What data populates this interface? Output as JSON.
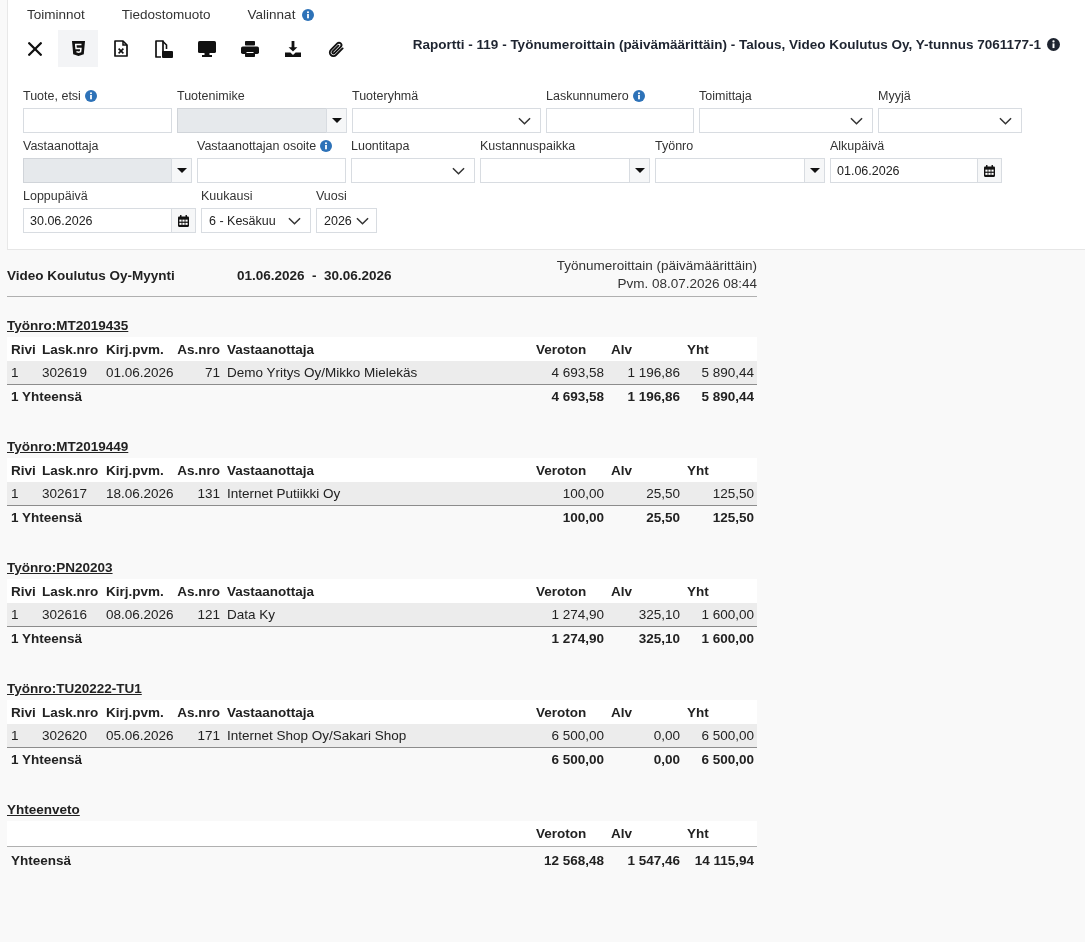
{
  "menu": [
    {
      "label": "Toiminnot",
      "info": false
    },
    {
      "label": "Tiedostomuoto",
      "info": false
    },
    {
      "label": "Valinnat",
      "info": true
    }
  ],
  "toolbar": [
    {
      "kind": "close",
      "selected": false
    },
    {
      "kind": "html",
      "selected": true
    },
    {
      "kind": "excel",
      "selected": false
    },
    {
      "kind": "pdf",
      "selected": false
    },
    {
      "kind": "screen",
      "selected": false
    },
    {
      "kind": "print",
      "selected": false
    },
    {
      "kind": "download",
      "selected": false
    },
    {
      "kind": "attach",
      "selected": false
    }
  ],
  "report_title": {
    "text": "Raportti - 119 - Työnumeroittain (päivämäärittäin) - Talous, Video Koulutus Oy, Y-tunnus 7061177-1",
    "info": true
  },
  "filters": [
    [
      {
        "label": "Tuote, etsi",
        "info": true,
        "kind": "text",
        "disabled": false
      },
      {
        "label": "Tuotenimike",
        "info": false,
        "kind": "combo",
        "disabled": true
      },
      {
        "label": "Tuoteryhmä",
        "info": false,
        "kind": "select",
        "disabled": false
      },
      {
        "label": "Laskunnumero",
        "info": true,
        "kind": "text",
        "disabled": false
      },
      {
        "label": "Toimittaja",
        "info": false,
        "kind": "select",
        "disabled": false
      },
      {
        "label": "Myyjä",
        "info": false,
        "kind": "select",
        "disabled": false
      }
    ],
    [
      {
        "label": "Vastaanottaja",
        "info": false,
        "kind": "combo",
        "disabled": true
      },
      {
        "label": "Vastaanottajan osoite",
        "info": true,
        "kind": "text",
        "disabled": false
      },
      {
        "label": "Luontitapa",
        "info": false,
        "kind": "select",
        "disabled": false
      },
      {
        "label": "Kustannuspaikka",
        "info": false,
        "kind": "combo",
        "disabled": false
      },
      {
        "label": "Työnro",
        "info": false,
        "kind": "combo",
        "disabled": false
      },
      {
        "label": "Alkupäivä",
        "info": false,
        "kind": "date",
        "disabled": false,
        "value": "01.06.2026"
      }
    ],
    [
      {
        "label": "Loppupäivä",
        "info": false,
        "kind": "date",
        "disabled": false,
        "value": "30.06.2026"
      },
      {
        "label": "Kuukausi",
        "info": false,
        "kind": "select",
        "disabled": false,
        "value": "6 - Kesäkuu"
      },
      {
        "label": "Vuosi",
        "info": false,
        "kind": "select",
        "disabled": false,
        "value": "2026"
      }
    ]
  ],
  "report": {
    "company": "Video Koulutus Oy-Myynti",
    "period": "01.06.2026  -  30.06.2026",
    "report_type": "Työnumeroittain (päivämäärittäin)",
    "printed": "Pvm. 08.07.2026 08:44",
    "groups": [
      {
        "title": "Työnro:MT2019435",
        "columns": [
          "Rivi",
          "Lask.nro",
          "Kirj.pvm.",
          "As.nro",
          "Vastaanottaja",
          "Veroton",
          "Alv",
          "Yht"
        ],
        "rows": [
          [
            "1",
            "302619",
            "01.06.2026",
            "71",
            "Demo Yritys Oy/Mikko Mielekäs",
            "4 693,58",
            "1 196,86",
            "5 890,44"
          ]
        ],
        "total": {
          "label": "1 Yhteensä",
          "values": [
            "4 693,58",
            "1 196,86",
            "5 890,44"
          ]
        }
      },
      {
        "title": "Työnro:MT2019449",
        "columns": [
          "Rivi",
          "Lask.nro",
          "Kirj.pvm.",
          "As.nro",
          "Vastaanottaja",
          "Veroton",
          "Alv",
          "Yht"
        ],
        "rows": [
          [
            "1",
            "302617",
            "18.06.2026",
            "131",
            "Internet Putiikki Oy",
            "100,00",
            "25,50",
            "125,50"
          ]
        ],
        "total": {
          "label": "1 Yhteensä",
          "values": [
            "100,00",
            "25,50",
            "125,50"
          ]
        }
      },
      {
        "title": "Työnro:PN20203",
        "columns": [
          "Rivi",
          "Lask.nro",
          "Kirj.pvm.",
          "As.nro",
          "Vastaanottaja",
          "Veroton",
          "Alv",
          "Yht"
        ],
        "rows": [
          [
            "1",
            "302616",
            "08.06.2026",
            "121",
            "Data Ky",
            "1 274,90",
            "325,10",
            "1 600,00"
          ]
        ],
        "total": {
          "label": "1 Yhteensä",
          "values": [
            "1 274,90",
            "325,10",
            "1 600,00"
          ]
        }
      },
      {
        "title": "Työnro:TU20222-TU1",
        "columns": [
          "Rivi",
          "Lask.nro",
          "Kirj.pvm.",
          "As.nro",
          "Vastaanottaja",
          "Veroton",
          "Alv",
          "Yht"
        ],
        "rows": [
          [
            "1",
            "302620",
            "05.06.2026",
            "171",
            "Internet Shop Oy/Sakari Shop",
            "6 500,00",
            "0,00",
            "6 500,00"
          ]
        ],
        "total": {
          "label": "1 Yhteensä",
          "values": [
            "6 500,00",
            "0,00",
            "6 500,00"
          ]
        }
      }
    ],
    "summary": {
      "title": "Yhteenveto",
      "columns": [
        "Veroton",
        "Alv",
        "Yht"
      ],
      "total": {
        "label": "Yhteensä",
        "values": [
          "12 568,48",
          "1 547,46",
          "14 115,94"
        ]
      }
    }
  }
}
